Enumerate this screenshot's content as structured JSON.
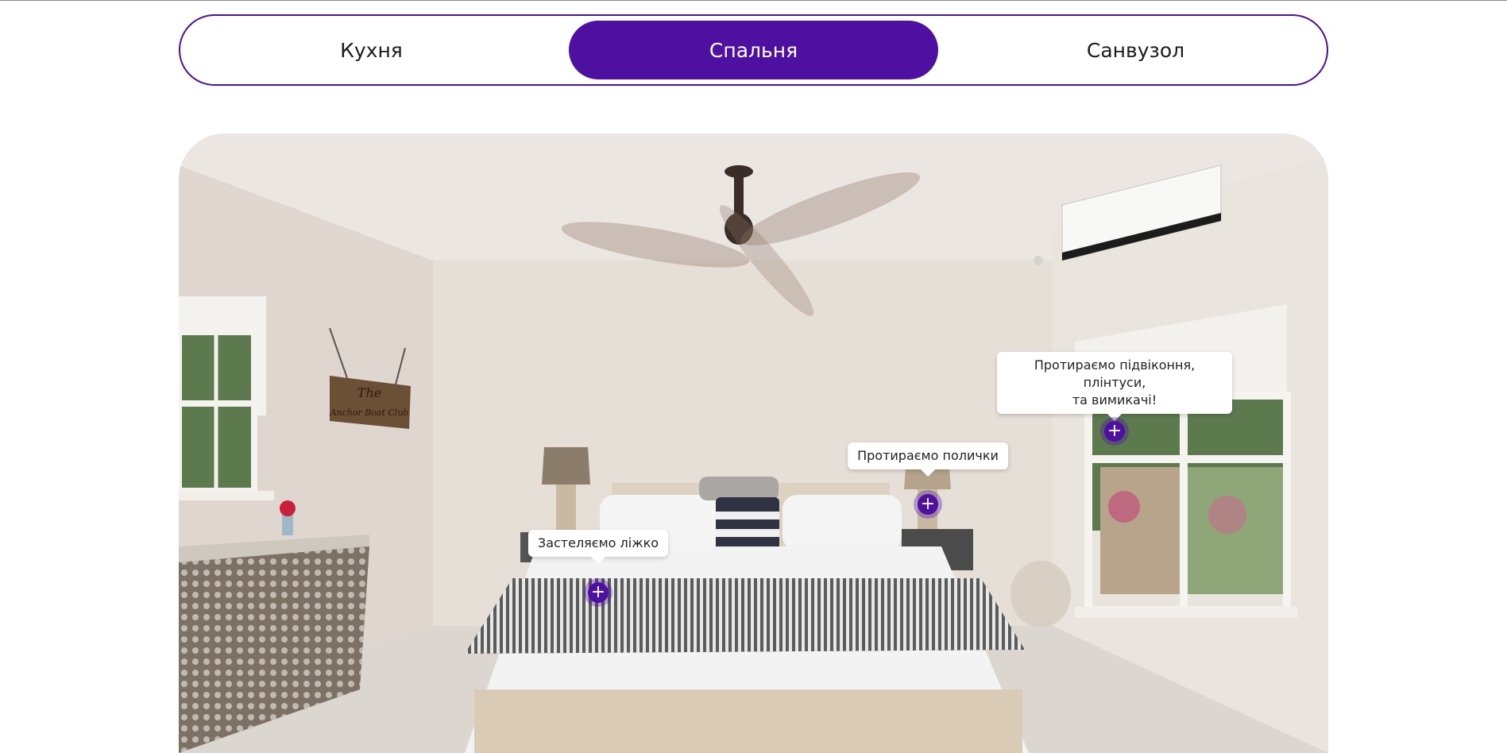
{
  "tabs": [
    {
      "label": "Кухня",
      "active": false
    },
    {
      "label": "Спальня",
      "active": true
    },
    {
      "label": "Санвузол",
      "active": false
    }
  ],
  "sign_text": {
    "line1": "The",
    "line2": "Anchor Boat Club"
  },
  "hotspots": {
    "bed": {
      "label": "Застеляємо ліжко"
    },
    "shelves": {
      "label": "Протираємо полички"
    },
    "windowsill": {
      "line1": "Протираємо підвіконня, плінтуси,",
      "line2": "та вимикачі!"
    }
  },
  "colors": {
    "accent": "#4e10a0"
  },
  "icons": {
    "hotspot": "plus-icon"
  }
}
